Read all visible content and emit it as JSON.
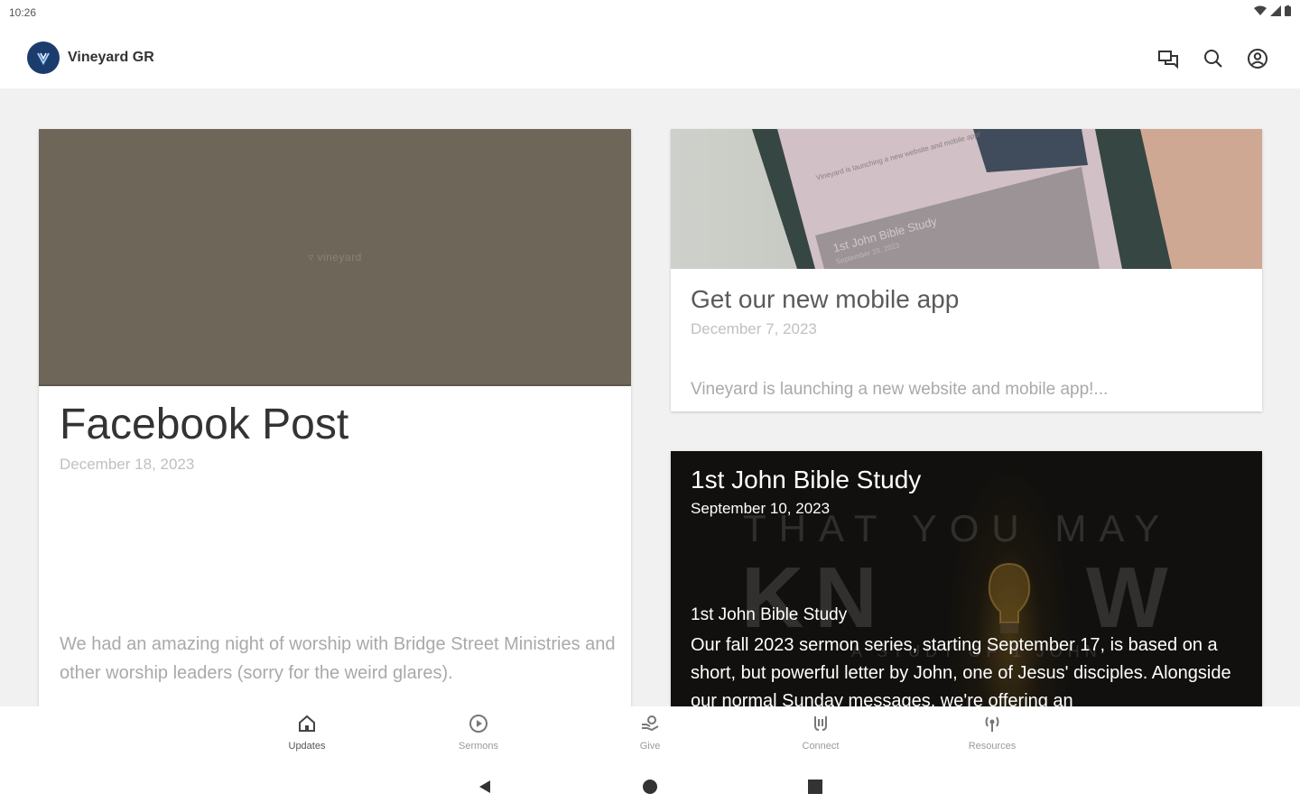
{
  "status_bar": {
    "time": "10:26"
  },
  "app_bar": {
    "title": "Vineyard GR",
    "icons": [
      "chat-icon",
      "search-icon",
      "account-icon"
    ]
  },
  "cards": {
    "facebook": {
      "watermark": "vineyard",
      "title": "Facebook Post",
      "date": "December 18, 2023",
      "description": "We had an amazing night of worship with Bridge Street Ministries and other worship leaders (sorry for the weird glares)."
    },
    "app": {
      "phone_text_1": "Vineyard is launching a new website and mobile app!",
      "phone_text_2": "1st John Bible Study",
      "phone_text_3": "September 10, 2023",
      "title": "Get our new mobile app",
      "date": "December 7, 2023",
      "description": "Vineyard is launching a new website and mobile app!..."
    },
    "study": {
      "bg_line_1": "THAT YOU MAY",
      "bg_line_2_left": "KN",
      "bg_line_2_right": "W",
      "bg_line_3": "A STUDY OF 1 JOHN",
      "title": "1st John Bible Study",
      "date": "September 10, 2023",
      "subtitle": "1st John Bible Study",
      "description": "Our fall 2023 sermon series, starting September 17, is based on a short, but powerful letter by John, one of Jesus' disciples. Alongside our normal Sunday messages, we're offering an"
    }
  },
  "bottom_nav": {
    "items": [
      {
        "label": "Updates",
        "icon": "home-icon"
      },
      {
        "label": "Sermons",
        "icon": "play-circle-icon"
      },
      {
        "label": "Give",
        "icon": "give-hand-icon"
      },
      {
        "label": "Connect",
        "icon": "connect-icon"
      },
      {
        "label": "Resources",
        "icon": "resources-icon"
      }
    ]
  },
  "colors": {
    "brand": "#1d3c6e",
    "background": "#f1f1f1",
    "media_placeholder": "#6e6659"
  }
}
